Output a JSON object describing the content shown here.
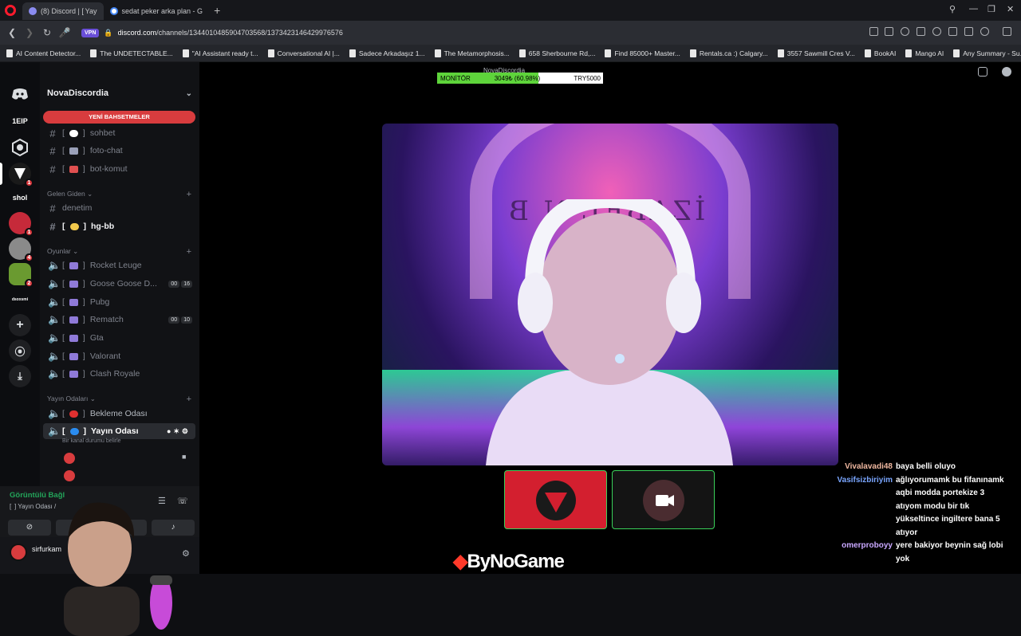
{
  "browser": {
    "tabs": [
      {
        "label": "(8) Discord | [ Yay",
        "active": true
      },
      {
        "label": "sedat peker arka plan - G",
        "active": false
      }
    ],
    "url_host": "discord.com",
    "url_path": "/channels/1344010485904703568/1373423146429976576",
    "vpn": "VPN",
    "bookmarks": [
      "AI Content Detector...",
      "The UNDETECTABLE...",
      "\"AI Assistant ready t...",
      "Conversational AI |...",
      "Sadece Arkadaşız 1...",
      "The Metamorphosis...",
      "658 Sherbourne Rd,...",
      "Find 85000+ Master...",
      "Rentals.ca :) Calgary...",
      "3557 Sawmill Cres V...",
      "BookAI",
      "Mango AI",
      "Any Summary - Su..."
    ]
  },
  "servers": {
    "items": [
      {
        "label": "1EIP"
      },
      {
        "label": "shol"
      },
      {
        "label": "dsoxsmi"
      }
    ],
    "badges": [
      "1",
      "1",
      "4",
      "2"
    ]
  },
  "guild": {
    "name": "NovaDiscordia",
    "mention_pill": "YENİ BAHSETMELER",
    "channels_top": [
      {
        "name": "sohbet"
      },
      {
        "name": "foto-chat"
      },
      {
        "name": "bot-komut"
      }
    ],
    "cat_gelen": "Gelen Giden",
    "channels_gelen": [
      {
        "name": "denetim"
      },
      {
        "name": "hg-bb"
      }
    ],
    "cat_oyunlar": "Oyunlar",
    "voice_games": [
      {
        "name": "Rocket Leuge"
      },
      {
        "name": "Goose Goose D...",
        "c1": "00",
        "c2": "16"
      },
      {
        "name": "Pubg"
      },
      {
        "name": "Rematch",
        "c1": "00",
        "c2": "10"
      },
      {
        "name": "Gta"
      },
      {
        "name": "Valorant"
      },
      {
        "name": "Clash Royale"
      }
    ],
    "cat_yayin": "Yayın Odaları",
    "voice_yayin": [
      {
        "name": "Bekleme Odası"
      },
      {
        "name": "Yayın Odası"
      }
    ],
    "channel_status": "Bir kanal durumu belirle"
  },
  "voice_panel": {
    "status": "Görüntülü Bağl",
    "channel": "[  ] Yayın Odası /",
    "username": "sirfurkam"
  },
  "stage": {
    "title": "NovaDiscordia",
    "monitor_label": "MONİTÖR",
    "monitor_value": "3049₺ (60.98%)",
    "monitor_fraction": 0.6098,
    "monitor_currency": "TRY5000",
    "sponsor": "ByNoGame",
    "video_sign": "İZABEL N   B"
  },
  "chat": [
    {
      "name": "Vivalavadi48",
      "color": "#f0b8a0",
      "text": "baya belli oluyo"
    },
    {
      "name": "Vasifsizbiriyim",
      "color": "#7aa6ff",
      "text": "ağlıyorumamk bu fifanınamk aqbi modda portekize 3 atıyom modu bir tık yükseltince ingiltere bana 5 atıyor"
    },
    {
      "name": "omerproboyy",
      "color": "#c9a8ff",
      "text": "yere bakiyor beynin sağ lobi yok"
    }
  ],
  "colors": {
    "accent_red": "#d83c3e",
    "voice_green": "#23a55a",
    "monitor_green": "#5ed43b"
  }
}
